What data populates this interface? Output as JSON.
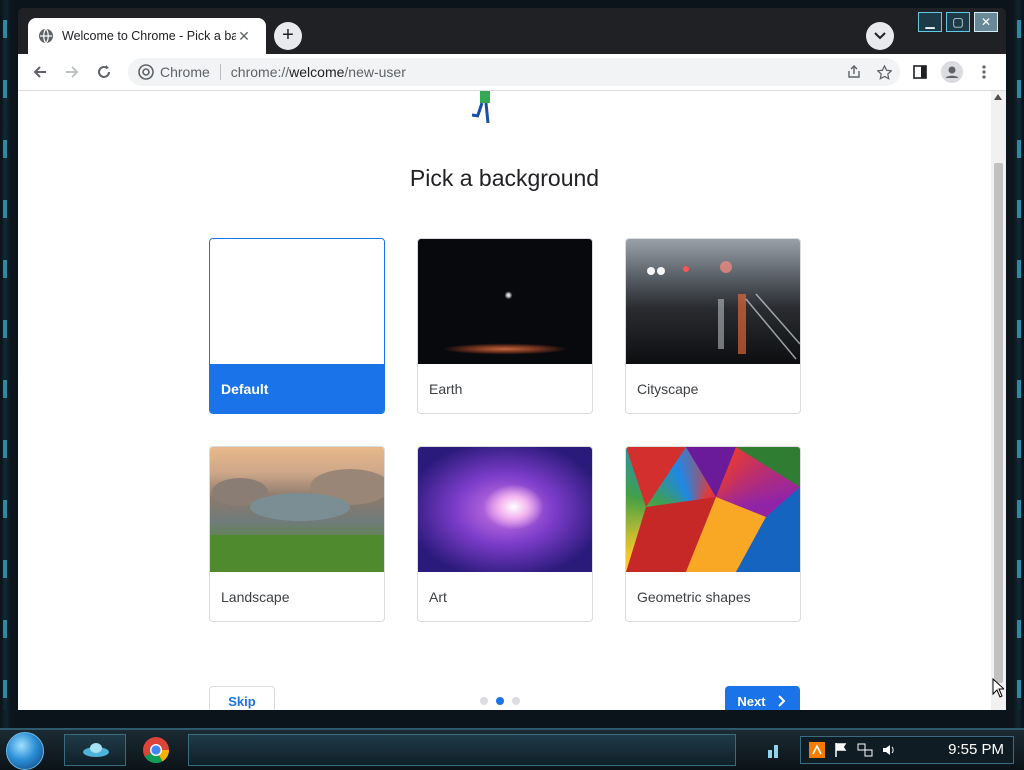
{
  "browser": {
    "tab_title": "Welcome to Chrome - Pick a background",
    "omnibox": {
      "chip": "Chrome",
      "url_scheme": "chrome://",
      "url_host": "welcome",
      "url_path": "/new-user"
    },
    "window_controls": [
      "minimize",
      "maximize",
      "close"
    ]
  },
  "page": {
    "heading": "Pick a background",
    "backgrounds": [
      {
        "label": "Default",
        "selected": true
      },
      {
        "label": "Earth",
        "selected": false
      },
      {
        "label": "Cityscape",
        "selected": false
      },
      {
        "label": "Landscape",
        "selected": false
      },
      {
        "label": "Art",
        "selected": false
      },
      {
        "label": "Geometric shapes",
        "selected": false
      }
    ],
    "skip_label": "Skip",
    "next_label": "Next",
    "step_dots": {
      "count": 3,
      "active_index": 1
    }
  },
  "taskbar": {
    "clock": "9:55 PM"
  },
  "colors": {
    "accent": "#1a73e8",
    "tab_strip": "#202124"
  }
}
